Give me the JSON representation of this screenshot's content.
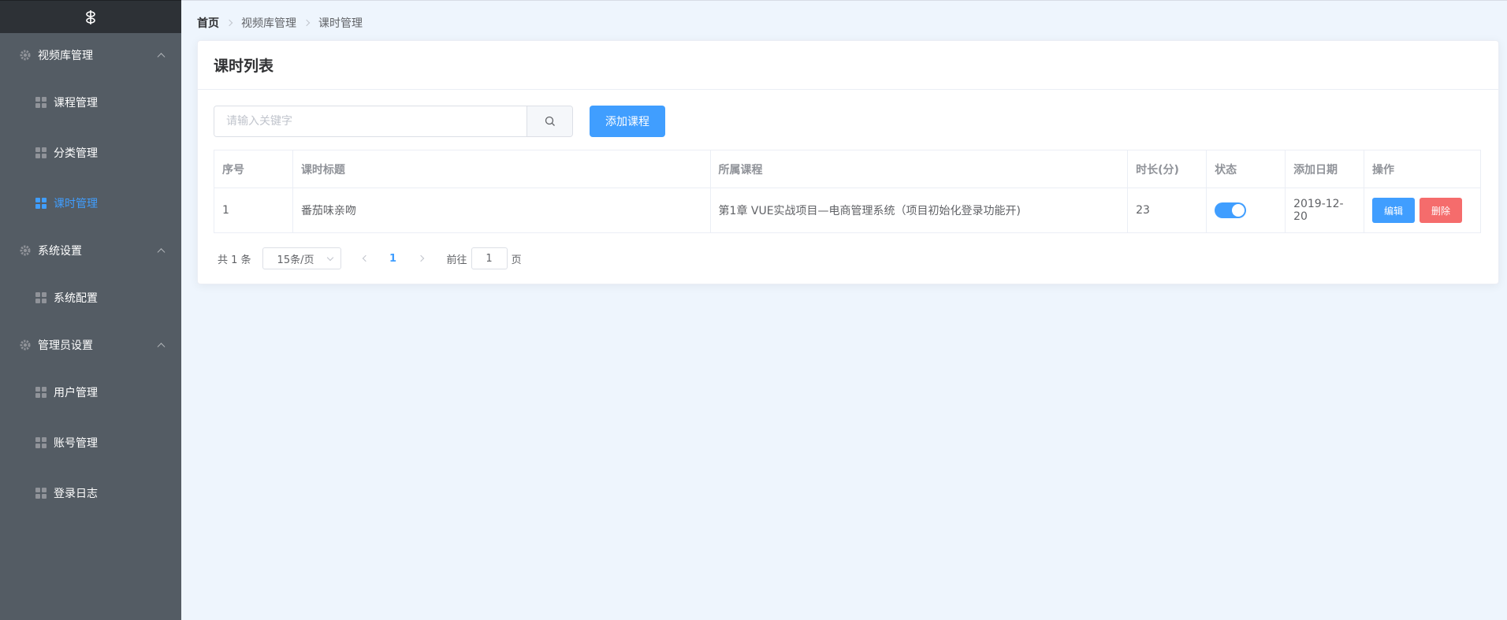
{
  "sidebar": {
    "groups": [
      {
        "title": "视频库管理",
        "items": [
          {
            "label": "课程管理"
          },
          {
            "label": "分类管理"
          },
          {
            "label": "课时管理"
          }
        ]
      },
      {
        "title": "系统设置",
        "items": [
          {
            "label": "系统配置"
          }
        ]
      },
      {
        "title": "管理员设置",
        "items": [
          {
            "label": "用户管理"
          },
          {
            "label": "账号管理"
          },
          {
            "label": "登录日志"
          }
        ]
      }
    ]
  },
  "breadcrumb": [
    "首页",
    "视频库管理",
    "课时管理"
  ],
  "card": {
    "title": "课时列表"
  },
  "toolbar": {
    "search_placeholder": "请输入关键字",
    "add_label": "添加课程"
  },
  "table": {
    "headers": [
      "序号",
      "课时标题",
      "所属课程",
      "时长(分)",
      "状态",
      "添加日期",
      "操作"
    ],
    "rows": [
      {
        "index": "1",
        "title": "番茄味亲吻",
        "course": "第1章 VUE实战项目—电商管理系统（项目初始化登录功能开)",
        "duration": "23",
        "status": true,
        "date": "2019-12-20",
        "edit": "编辑",
        "delete": "删除"
      }
    ]
  },
  "pagination": {
    "total_text": "共 1 条",
    "page_size": "15条/页",
    "current_page": "1",
    "goto_prefix": "前往",
    "goto_value": "1",
    "goto_suffix": "页"
  },
  "colors": {
    "accent": "#409eff",
    "danger": "#f56c6c",
    "sidebar_bg": "#545c64"
  }
}
